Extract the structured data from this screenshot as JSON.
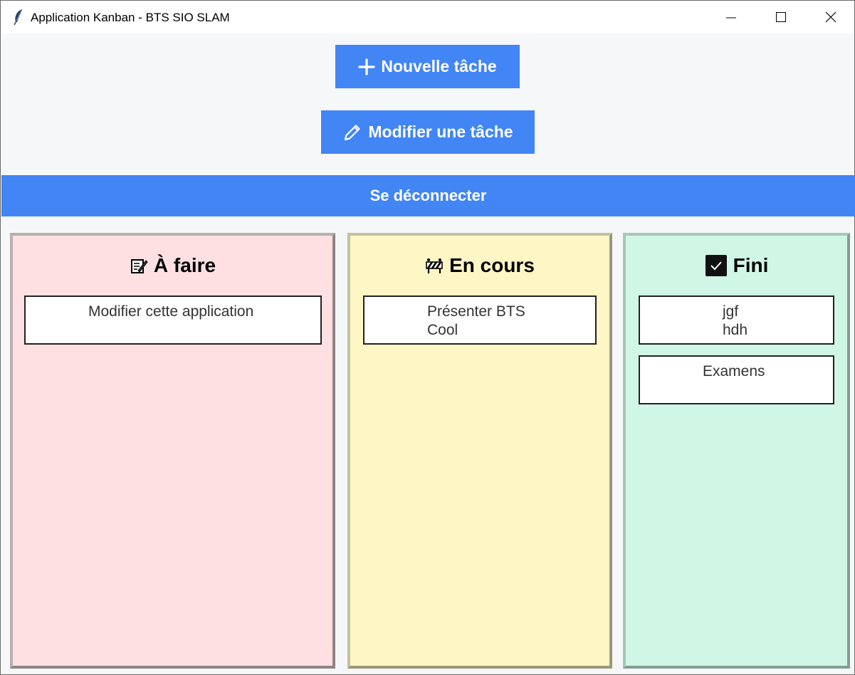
{
  "window": {
    "title": "Application Kanban - BTS SIO SLAM",
    "app_icon": "feather-icon",
    "controls": [
      "minimize-icon",
      "maximize-icon",
      "close-icon"
    ]
  },
  "toolbar": {
    "new_task_label": "Nouvelle tâche",
    "new_task_icon": "plus-icon",
    "edit_task_label": "Modifier une tâche",
    "edit_task_icon": "pencil-icon",
    "logout_label": "Se déconnecter"
  },
  "colors": {
    "accent": "#4285f4",
    "todo_bg": "#ffe0e2",
    "doing_bg": "#fef7c5",
    "done_bg": "#d0f7e5"
  },
  "columns": [
    {
      "title": "À faire",
      "icon": "memo-icon",
      "cards": [
        "Modifier cette application"
      ]
    },
    {
      "title": "En cours",
      "icon": "construction-icon",
      "cards": [
        "Présenter BTS\nCool"
      ]
    },
    {
      "title": "Fini",
      "icon": "check-box-icon",
      "cards": [
        "jgf\nhdh",
        "Examens"
      ]
    }
  ]
}
